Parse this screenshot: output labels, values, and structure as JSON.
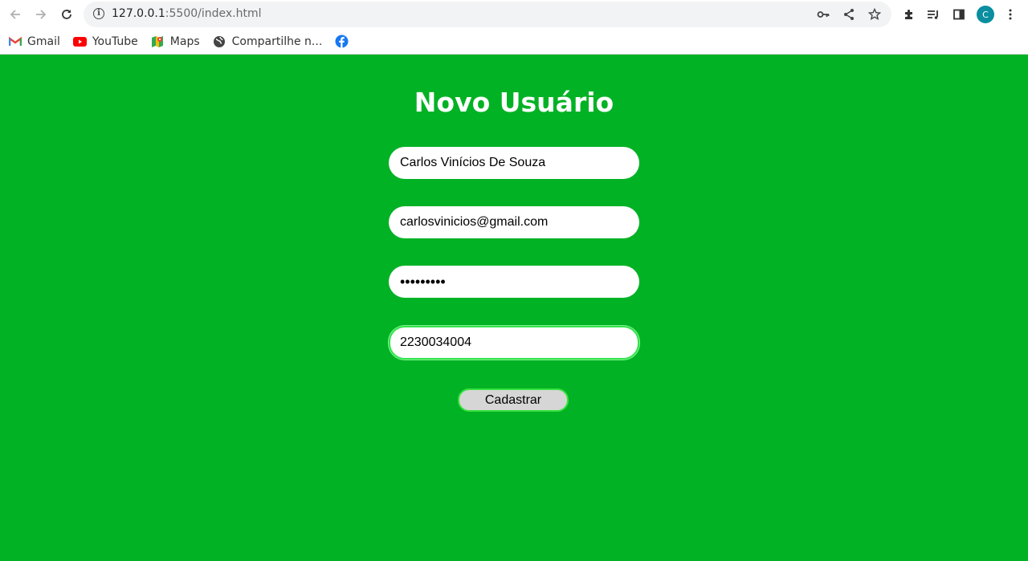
{
  "browser": {
    "url_host": "127.0.0.1",
    "url_rest": ":5500/index.html",
    "profile_initial": "C",
    "bookmarks": [
      {
        "label": "Gmail",
        "icon": "gmail-icon"
      },
      {
        "label": "YouTube",
        "icon": "youtube-icon"
      },
      {
        "label": "Maps",
        "icon": "maps-icon"
      },
      {
        "label": "Compartilhe n...",
        "icon": "globe-icon"
      },
      {
        "label": "",
        "icon": "facebook-icon"
      }
    ]
  },
  "form": {
    "title": "Novo Usuário",
    "name_value": "Carlos Vinícios De Souza",
    "email_value": "carlosvinicios@gmail.com",
    "password_value": "•••••••••",
    "phone_value": "2230034004",
    "submit_label": "Cadastrar"
  },
  "colors": {
    "page_background": "#00b224",
    "field_background": "#ffffff",
    "button_background": "#d6d6d6",
    "focus_border": "#34e34d"
  }
}
